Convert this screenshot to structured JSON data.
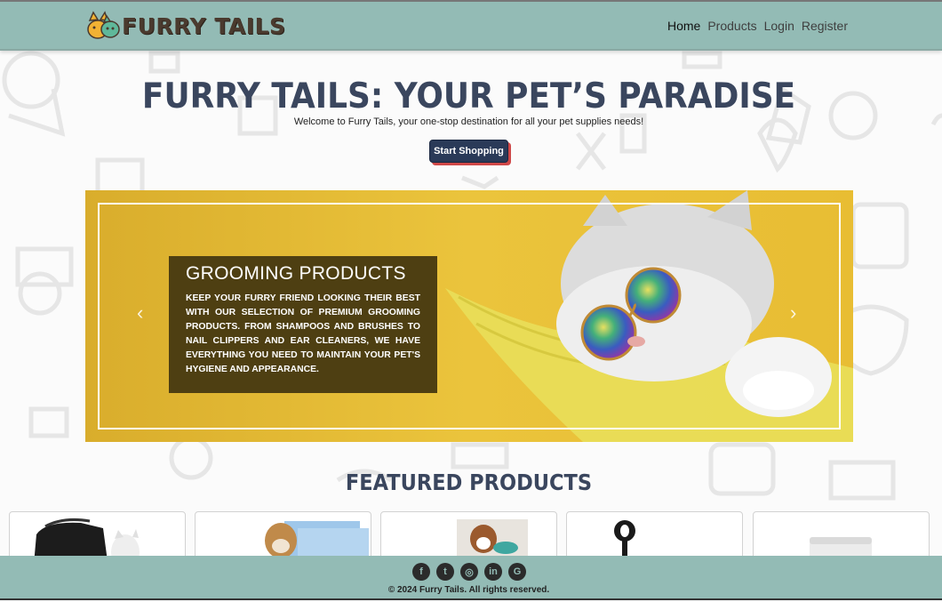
{
  "brand": {
    "name": "FURRY TAILS",
    "logo_icon": "pets-logo-icon"
  },
  "nav": {
    "items": [
      {
        "label": "Home",
        "active": true
      },
      {
        "label": "Products",
        "active": false
      },
      {
        "label": "Login",
        "active": false
      },
      {
        "label": "Register",
        "active": false
      }
    ]
  },
  "hero": {
    "title": "FURRY TAILS: YOUR PET’S PARADISE",
    "subtitle": "Welcome to Furry Tails, your one-stop destination for all your pet supplies needs!",
    "cta_label": "Start Shopping"
  },
  "carousel": {
    "slide_title": "GROOMING PRODUCTS",
    "slide_text": "Keep your furry friend looking their best with our selection of premium grooming products. From shampoos and brushes to nail clippers and ear cleaners, we have everything you need to maintain your pet's hygiene and appearance.",
    "prev_icon": "chevron-left-icon",
    "next_icon": "chevron-right-icon",
    "colors": {
      "background": "#e9c13a",
      "caption_bg": "#4e3f12"
    }
  },
  "featured": {
    "title": "FEATURED PRODUCTS",
    "products": [
      {
        "image": "pet-carrier-with-cat"
      },
      {
        "image": "puppy-training-pads"
      },
      {
        "image": "dog-with-bowl"
      },
      {
        "image": "poop-scooper"
      },
      {
        "image": "supplement-jar"
      }
    ]
  },
  "footer": {
    "social": [
      {
        "icon": "facebook-icon",
        "glyph": "f"
      },
      {
        "icon": "twitter-icon",
        "glyph": "t"
      },
      {
        "icon": "instagram-icon",
        "glyph": "◎"
      },
      {
        "icon": "linkedin-icon",
        "glyph": "in"
      },
      {
        "icon": "google-icon",
        "glyph": "G"
      }
    ],
    "copyright": "© 2024 Furry Tails. All rights reserved."
  },
  "colors": {
    "navbar": "#93bbb5",
    "heading": "#3a465e",
    "cta": "#2a3a58",
    "cta_shadow": "#d04848"
  }
}
